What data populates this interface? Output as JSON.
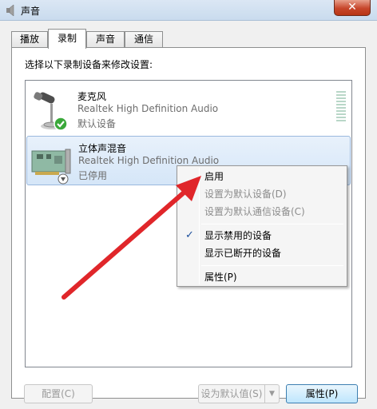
{
  "window": {
    "title": "声音",
    "close_label": "✕"
  },
  "tabs": [
    {
      "label": "播放",
      "active": false
    },
    {
      "label": "录制",
      "active": true
    },
    {
      "label": "声音",
      "active": false
    },
    {
      "label": "通信",
      "active": false
    }
  ],
  "panel": {
    "instruction": "选择以下录制设备来修改设置:"
  },
  "devices": [
    {
      "name": "麦克风",
      "driver": "Realtek High Definition Audio",
      "status": "默认设备",
      "icon": "microphone-icon",
      "badge": "green-check-icon",
      "selected": false
    },
    {
      "name": "立体声混音",
      "driver": "Realtek High Definition Audio",
      "status": "已停用",
      "icon": "sound-card-icon",
      "badge": "disabled-arrow-icon",
      "selected": true
    }
  ],
  "context_menu": {
    "items": [
      {
        "label": "启用",
        "enabled": true,
        "checked": false
      },
      {
        "label": "设置为默认设备(D)",
        "enabled": false,
        "checked": false
      },
      {
        "label": "设置为默认通信设备(C)",
        "enabled": false,
        "checked": false
      },
      {
        "label": "显示禁用的设备",
        "enabled": true,
        "checked": true
      },
      {
        "label": "显示已断开的设备",
        "enabled": true,
        "checked": false
      },
      {
        "label": "属性(P)",
        "enabled": true,
        "checked": false
      }
    ]
  },
  "buttons": {
    "configure": "配置(C)",
    "set_default": "设为默认值(S)",
    "properties": "属性(P)"
  },
  "colors": {
    "selection": "#d5e6f8",
    "annotation_arrow": "#e0262a",
    "check_green": "#3aa83a"
  }
}
